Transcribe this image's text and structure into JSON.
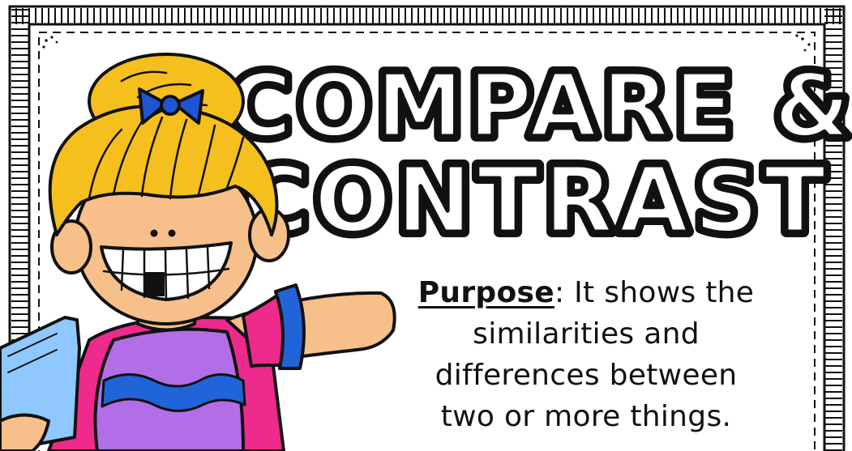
{
  "poster": {
    "title_line1": "COMPARE &",
    "title_line2": "CONTRAST",
    "purpose_label": "Purpose",
    "purpose_line1_rest": ": It shows the",
    "purpose_line2": "similarities and",
    "purpose_line3": "differences between",
    "purpose_line4": "two or more things."
  },
  "colors": {
    "frame": "#111111",
    "hair": "#f5c01e",
    "bow": "#1f54d6",
    "skin": "#f7c08a",
    "shirt_pink": "#ee2a8c",
    "shirt_purple": "#b26ee6",
    "shirt_blue": "#1f64d9",
    "book": "#8ec8ff"
  },
  "icons": {
    "character": "girl-holding-book-illustration",
    "border": "hand-drawn-tick-border"
  }
}
